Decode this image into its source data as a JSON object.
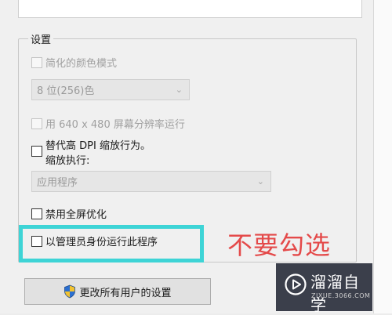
{
  "settings": {
    "group_title": "设置",
    "reduced_color_mode": {
      "label": "简化的颜色模式",
      "checked": false,
      "disabled": true
    },
    "color_depth": {
      "value": "8 位(256)色",
      "disabled": true
    },
    "run_640x480": {
      "label": "用 640 x 480 屏幕分辨率运行",
      "checked": false,
      "disabled": true
    },
    "override_dpi": {
      "label_line1": "替代高 DPI 缩放行为。",
      "label_line2": "缩放执行:",
      "checked": false
    },
    "dpi_scaling": {
      "value": "应用程序",
      "disabled": true
    },
    "disable_fullscreen_opt": {
      "label": "禁用全屏优化",
      "checked": false
    },
    "run_as_admin": {
      "label": "以管理员身份运行此程序",
      "checked": false
    }
  },
  "change_all_users_button": {
    "label": "更改所有用户的设置",
    "icon": "shield-icon"
  },
  "annotation": {
    "text": "不要勾选",
    "color": "#e44a4a",
    "highlight_color": "#3ed4d6"
  },
  "watermark": {
    "name": "溜溜自学",
    "domain": "ZIXUE.3066.COM"
  }
}
